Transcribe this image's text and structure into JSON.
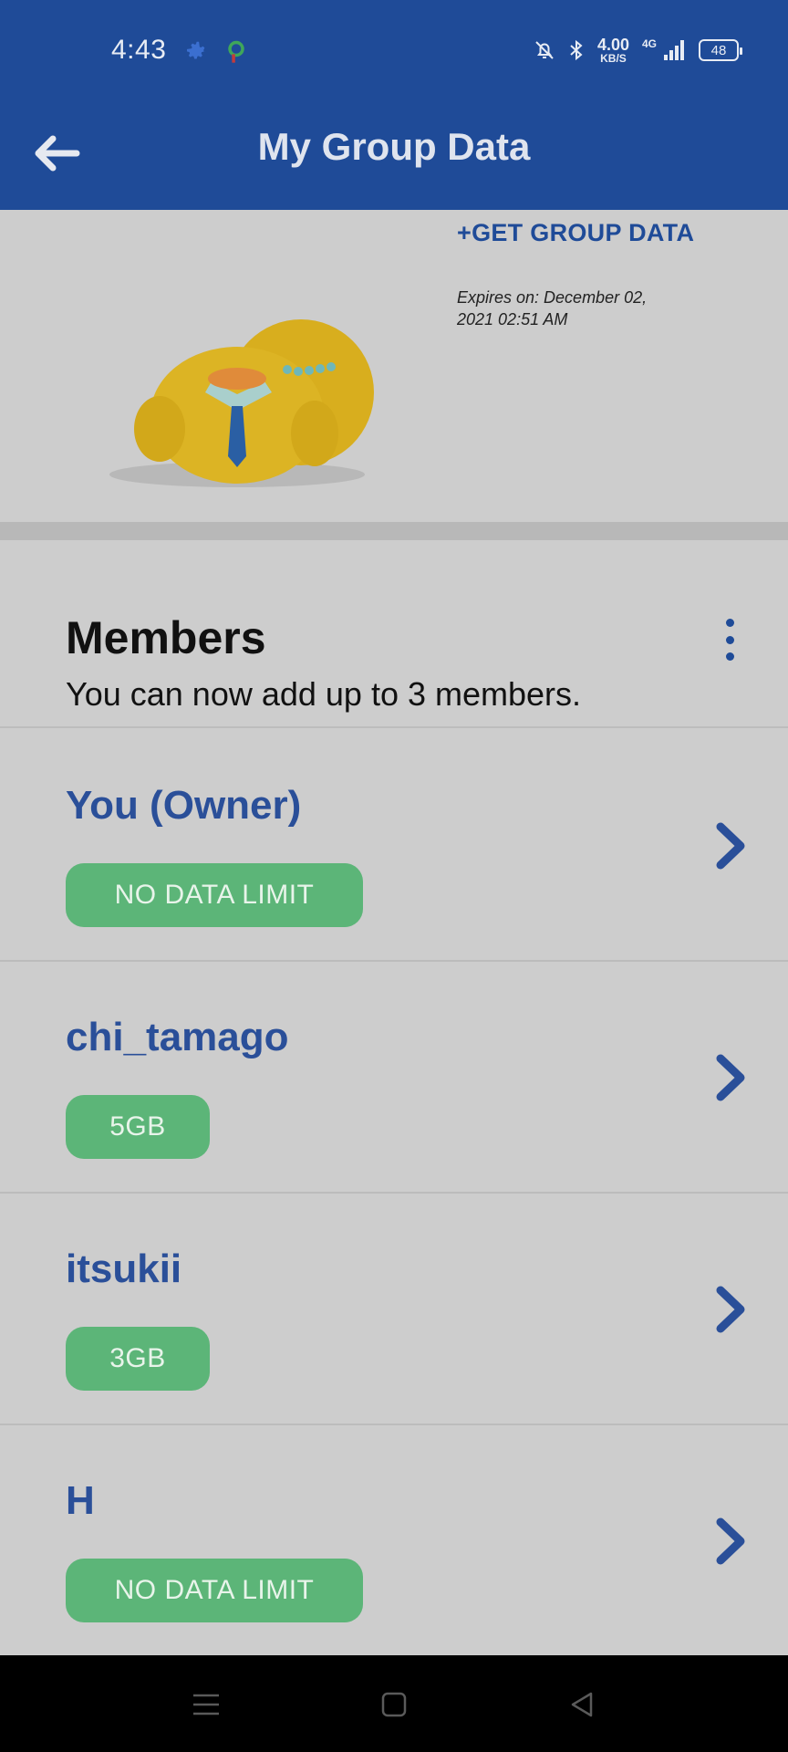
{
  "status_bar": {
    "time": "4:43",
    "speed_value": "4.00",
    "speed_unit": "KB/S",
    "network": "4G",
    "battery": "48"
  },
  "app_bar": {
    "title": "My Group Data",
    "back_icon": "arrow-left-icon"
  },
  "top_card": {
    "get_group_data_label": "+GET GROUP DATA",
    "expires_text": "Expires on: December 02, 2021 02:51 AM"
  },
  "members": {
    "title": "Members",
    "subtitle": "You can now add up to 3 members.",
    "list": [
      {
        "name": "You (Owner)",
        "limit": "NO DATA LIMIT"
      },
      {
        "name": "chi_tamago",
        "limit": "5GB"
      },
      {
        "name": "itsukii",
        "limit": "3GB"
      },
      {
        "name": "H",
        "limit": "NO DATA LIMIT"
      }
    ]
  },
  "colors": {
    "primary": "#1f4b98",
    "pill_green": "#5cb578",
    "background": "#cdcdcd"
  }
}
